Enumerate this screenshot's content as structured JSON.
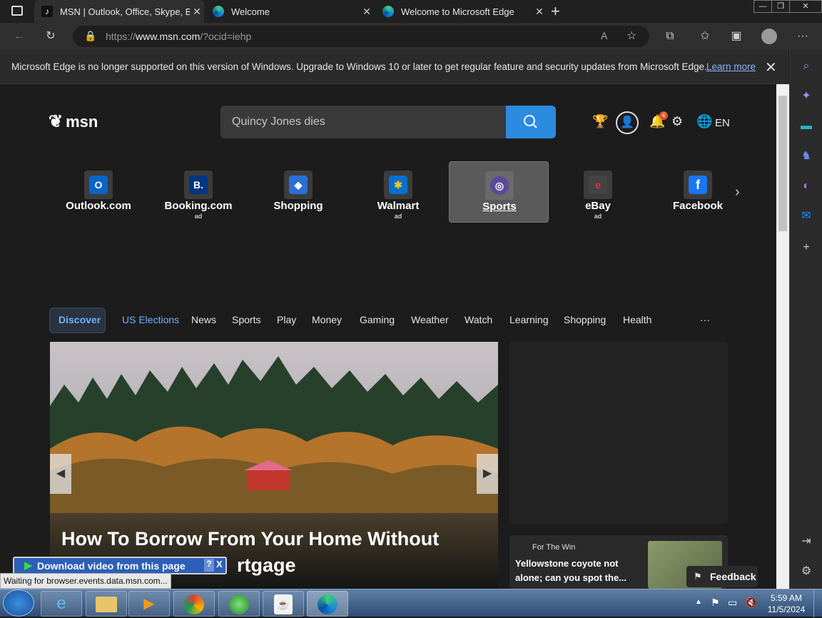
{
  "browser": {
    "tabs": [
      {
        "title": "MSN | Outlook, Office, Skype, Bing",
        "active": true
      },
      {
        "title": "Welcome",
        "active": false
      },
      {
        "title": "Welcome to Microsoft Edge",
        "active": false
      }
    ],
    "new_tab": "+",
    "url_prefix": "https://",
    "url_host": "www.msn.com",
    "url_rest": "/?ocid=iehp",
    "colors": {
      "chrome": "#202020",
      "toolbar": "#2f2f2f",
      "accent": "#2b8be0"
    }
  },
  "infobar": {
    "message": "Microsoft Edge is no longer supported on this version of Windows. Upgrade to Windows 10 or later to get regular feature and security updates from Microsoft Edge.",
    "link": "Learn more"
  },
  "msn": {
    "logo": "msn",
    "search_value": "Quincy Jones dies",
    "notifications_count": "4",
    "language": "EN",
    "quick_links": [
      {
        "label": "Outlook.com",
        "ad": "",
        "icon": "outlook-icon",
        "color": "#0a64c8",
        "glyph": "O"
      },
      {
        "label": "Booking.com",
        "ad": "ad",
        "icon": "booking-icon",
        "color": "#003580",
        "glyph": "B."
      },
      {
        "label": "Shopping",
        "ad": "",
        "icon": "shopping-tag-icon",
        "color": "#2b6fd6",
        "glyph": "◆"
      },
      {
        "label": "Walmart",
        "ad": "ad",
        "icon": "walmart-icon",
        "color": "#0071ce",
        "glyph": "✱"
      },
      {
        "label": "Sports",
        "ad": "",
        "icon": "sports-icon",
        "color": "#5a4a9a",
        "glyph": "◎"
      },
      {
        "label": "eBay",
        "ad": "ad",
        "icon": "ebay-icon",
        "color": "#444444",
        "glyph": "e"
      },
      {
        "label": "Facebook",
        "ad": "",
        "icon": "facebook-icon",
        "color": "#1877f2",
        "glyph": "f"
      }
    ],
    "nav": [
      "Discover",
      "US Elections",
      "News",
      "Sports",
      "Play",
      "Money",
      "Gaming",
      "Weather",
      "Watch",
      "Learning",
      "Shopping",
      "Health"
    ],
    "nav_more": "···",
    "hero": {
      "headline_1": "How To Borrow From Your Home Without",
      "headline_2": "rtgage"
    },
    "card": {
      "source": "For The Win",
      "title": "Yellowstone coyote not alone; can you spot the..."
    },
    "feedback": "Feedback"
  },
  "overlays": {
    "download": "Download video from this page",
    "download_help": "?",
    "download_close": "X",
    "status": "Waiting for browser.events.data.msn.com..."
  },
  "taskbar": {
    "time": "5:59 AM",
    "date": "11/5/2024"
  }
}
